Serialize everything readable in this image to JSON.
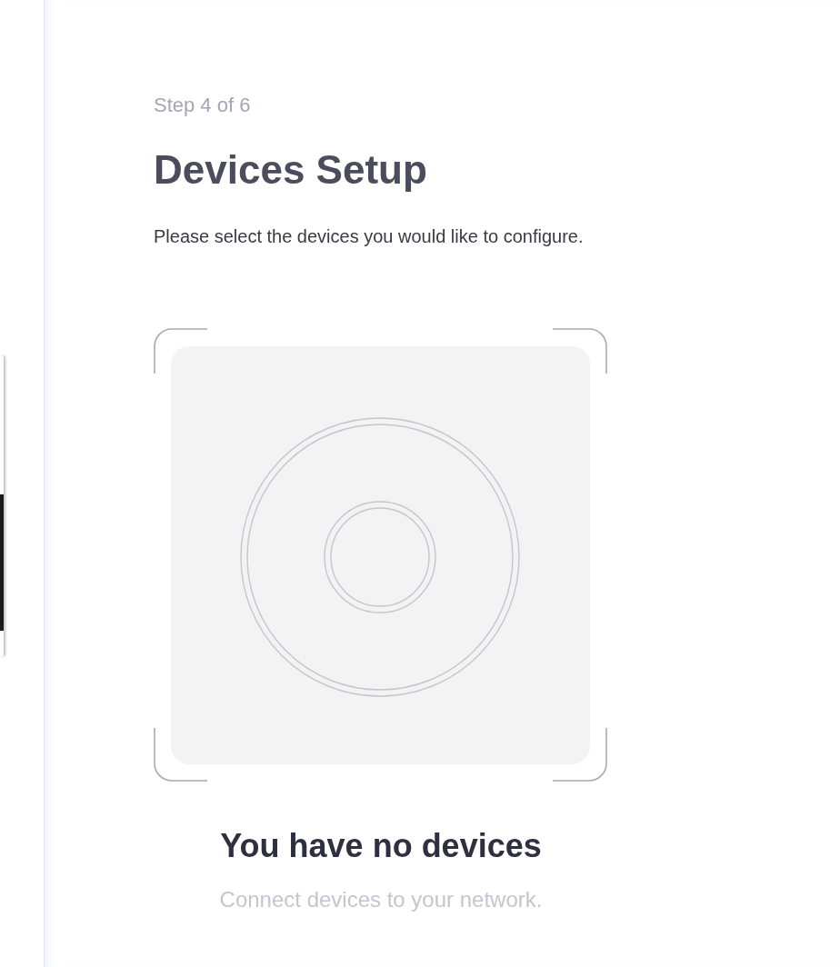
{
  "header": {
    "step": "Step 4 of 6",
    "title": "Devices Setup",
    "description": "Please select the devices you would like to configure."
  },
  "empty_state": {
    "title": "You have no devices",
    "message": "Connect devices to your network."
  }
}
